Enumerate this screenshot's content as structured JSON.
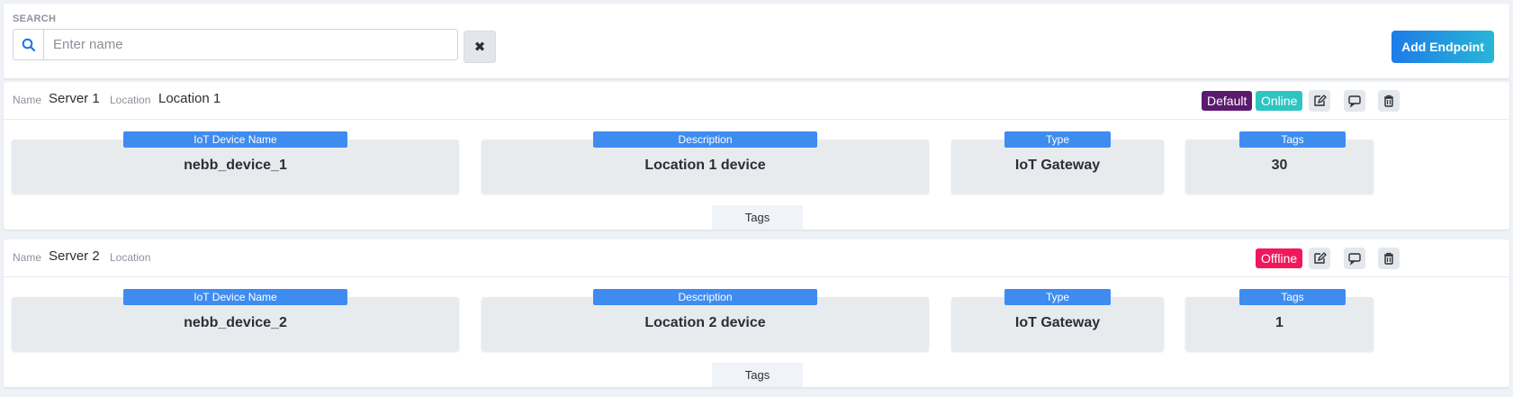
{
  "search": {
    "caption": "SEARCH",
    "placeholder": "Enter name",
    "value": "",
    "clear_symbol": "✖",
    "add_button_label": "Add Endpoint"
  },
  "colors": {
    "default_badge": "#5b1a6e",
    "online_badge": "#2ec4c4",
    "offline_badge": "#f0185c",
    "field_label": "#3f8cf0"
  },
  "servers": [
    {
      "name_label": "Name",
      "name": "Server 1",
      "location_label": "Location",
      "location": "Location 1",
      "badges": [
        "Default",
        "Online"
      ],
      "fields": {
        "device_name_label": "IoT Device Name",
        "device_name": "nebb_device_1",
        "description_label": "Description",
        "description": "Location 1 device",
        "type_label": "Type",
        "type": "IoT Gateway",
        "tags_label": "Tags",
        "tags": "30"
      },
      "tags_tab": "Tags"
    },
    {
      "name_label": "Name",
      "name": "Server 2",
      "location_label": "Location",
      "location": "",
      "badges": [
        "Offline"
      ],
      "fields": {
        "device_name_label": "IoT Device Name",
        "device_name": "nebb_device_2",
        "description_label": "Description",
        "description": "Location 2 device",
        "type_label": "Type",
        "type": "IoT Gateway",
        "tags_label": "Tags",
        "tags": "1"
      },
      "tags_tab": "Tags"
    }
  ],
  "icons": [
    "search-icon",
    "close-icon",
    "edit-icon",
    "comment-icon",
    "trash-icon"
  ]
}
